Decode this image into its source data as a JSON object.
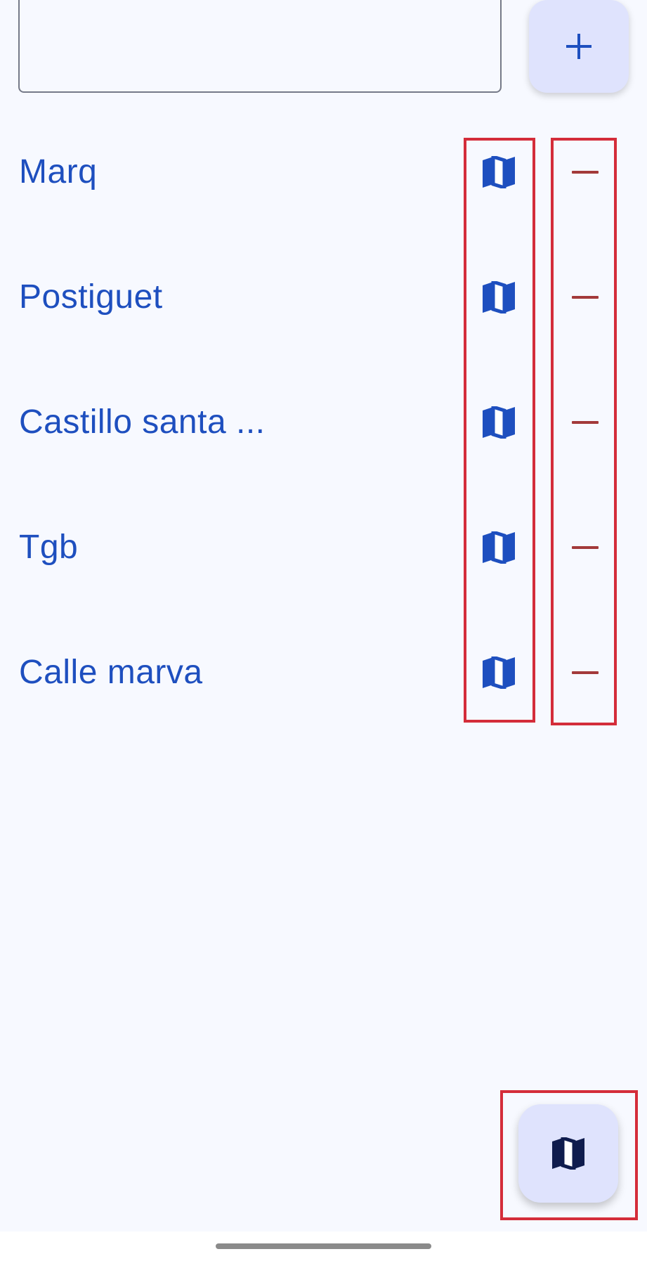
{
  "search": {
    "value": "",
    "placeholder": ""
  },
  "add_button": {
    "icon": "plus-icon"
  },
  "items": [
    {
      "label": "Marq"
    },
    {
      "label": "Postiguet"
    },
    {
      "label": "Castillo santa ..."
    },
    {
      "label": "Tgb"
    },
    {
      "label": "Calle marva"
    }
  ],
  "row_icons": {
    "map": "map-icon",
    "remove": "minus-icon"
  },
  "fab": {
    "icon": "map-icon"
  },
  "colors": {
    "background": "#f7f9ff",
    "accent": "#1e4fbf",
    "button_bg": "#dfe3fd",
    "remove": "#a33a3a",
    "highlight": "#d42d3a",
    "fab_icon": "#0f1c4d"
  }
}
